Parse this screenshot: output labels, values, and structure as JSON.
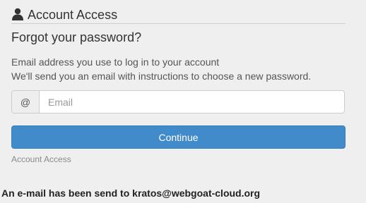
{
  "header": {
    "title": "Account Access",
    "icon": "user-icon"
  },
  "form": {
    "title": "Forgot your password?",
    "instruction_line1": "Email address you use to log in to your account",
    "instruction_line2": "We'll send you an email with instructions to choose a new password.",
    "email_addon": "@",
    "email_placeholder": "Email",
    "email_value": "",
    "continue_label": "Continue",
    "footer_link": "Account Access"
  },
  "status": {
    "message": "An e-mail has been send to kratos@webgoat-cloud.org"
  },
  "colors": {
    "background": "#efefef",
    "primary_button": "#428bca",
    "text": "#333333",
    "muted_text": "#8a8a8a"
  }
}
